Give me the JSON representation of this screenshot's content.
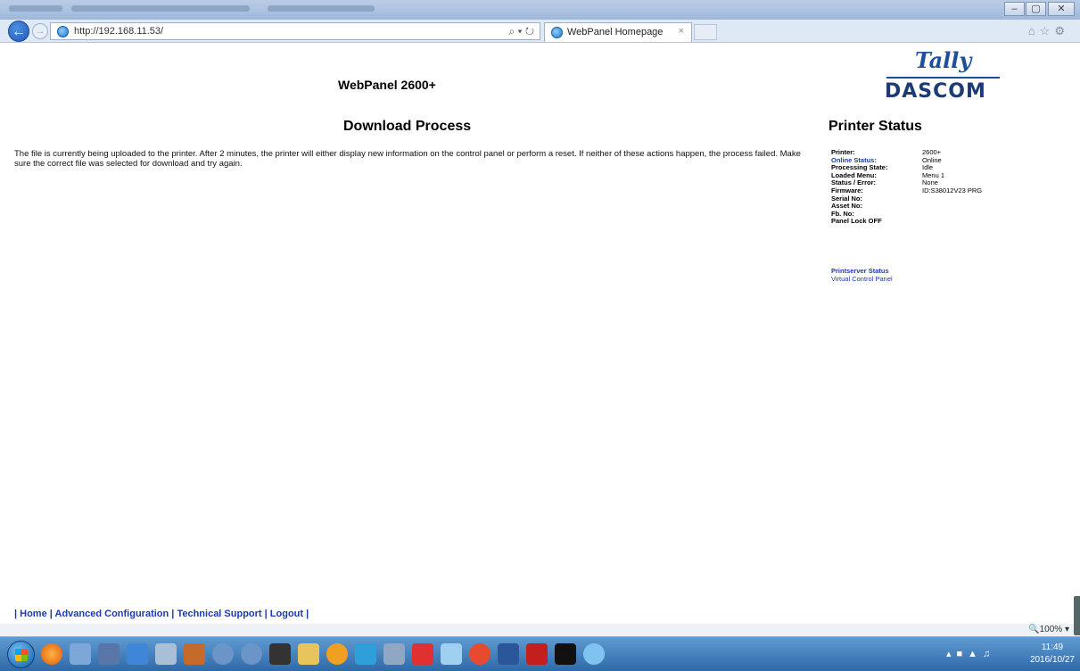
{
  "browser": {
    "url": "http://192.168.11.53/",
    "search_controls": "⌕ ▾ ↻",
    "tab_title": "WebPanel Homepage",
    "tab_close": "×",
    "zoom": "100%",
    "window_controls": [
      "–",
      "▢",
      "✕"
    ]
  },
  "header": {
    "panel_title": "WebPanel 2600+",
    "logo_top": "Tally",
    "logo_bottom": "DASCOM"
  },
  "main": {
    "section_title": "Download Process",
    "message": "The file is currently being uploaded to the printer. After 2 minutes, the printer will either display new information on the control panel or perform a reset. If neither of these actions happen, the process failed. Make sure the correct file was selected for download and try again."
  },
  "status": {
    "title": "Printer Status",
    "rows": [
      {
        "label": "Printer:",
        "value": "2600+"
      },
      {
        "label": "Online Status:",
        "value": "Online"
      },
      {
        "label": "Processing State:",
        "value": "Idle"
      },
      {
        "label": "Loaded Menu:",
        "value": "Menu 1"
      },
      {
        "label": "Status / Error:",
        "value": "None"
      },
      {
        "label": "Firmware:",
        "value": "ID:S38012V23 PRG"
      },
      {
        "label": "Serial No:",
        "value": ""
      },
      {
        "label": "Asset No:",
        "value": ""
      },
      {
        "label": "Fb. No:",
        "value": ""
      },
      {
        "label": "Panel Lock OFF",
        "value": ""
      }
    ],
    "links": [
      "Printserver Status",
      "Virtual Control Panel"
    ]
  },
  "footer": {
    "links": [
      "Home",
      "Advanced Configuration",
      "Technical Support",
      "Logout"
    ]
  },
  "taskbar": {
    "time": "11:49",
    "date": "2016/10/27"
  }
}
